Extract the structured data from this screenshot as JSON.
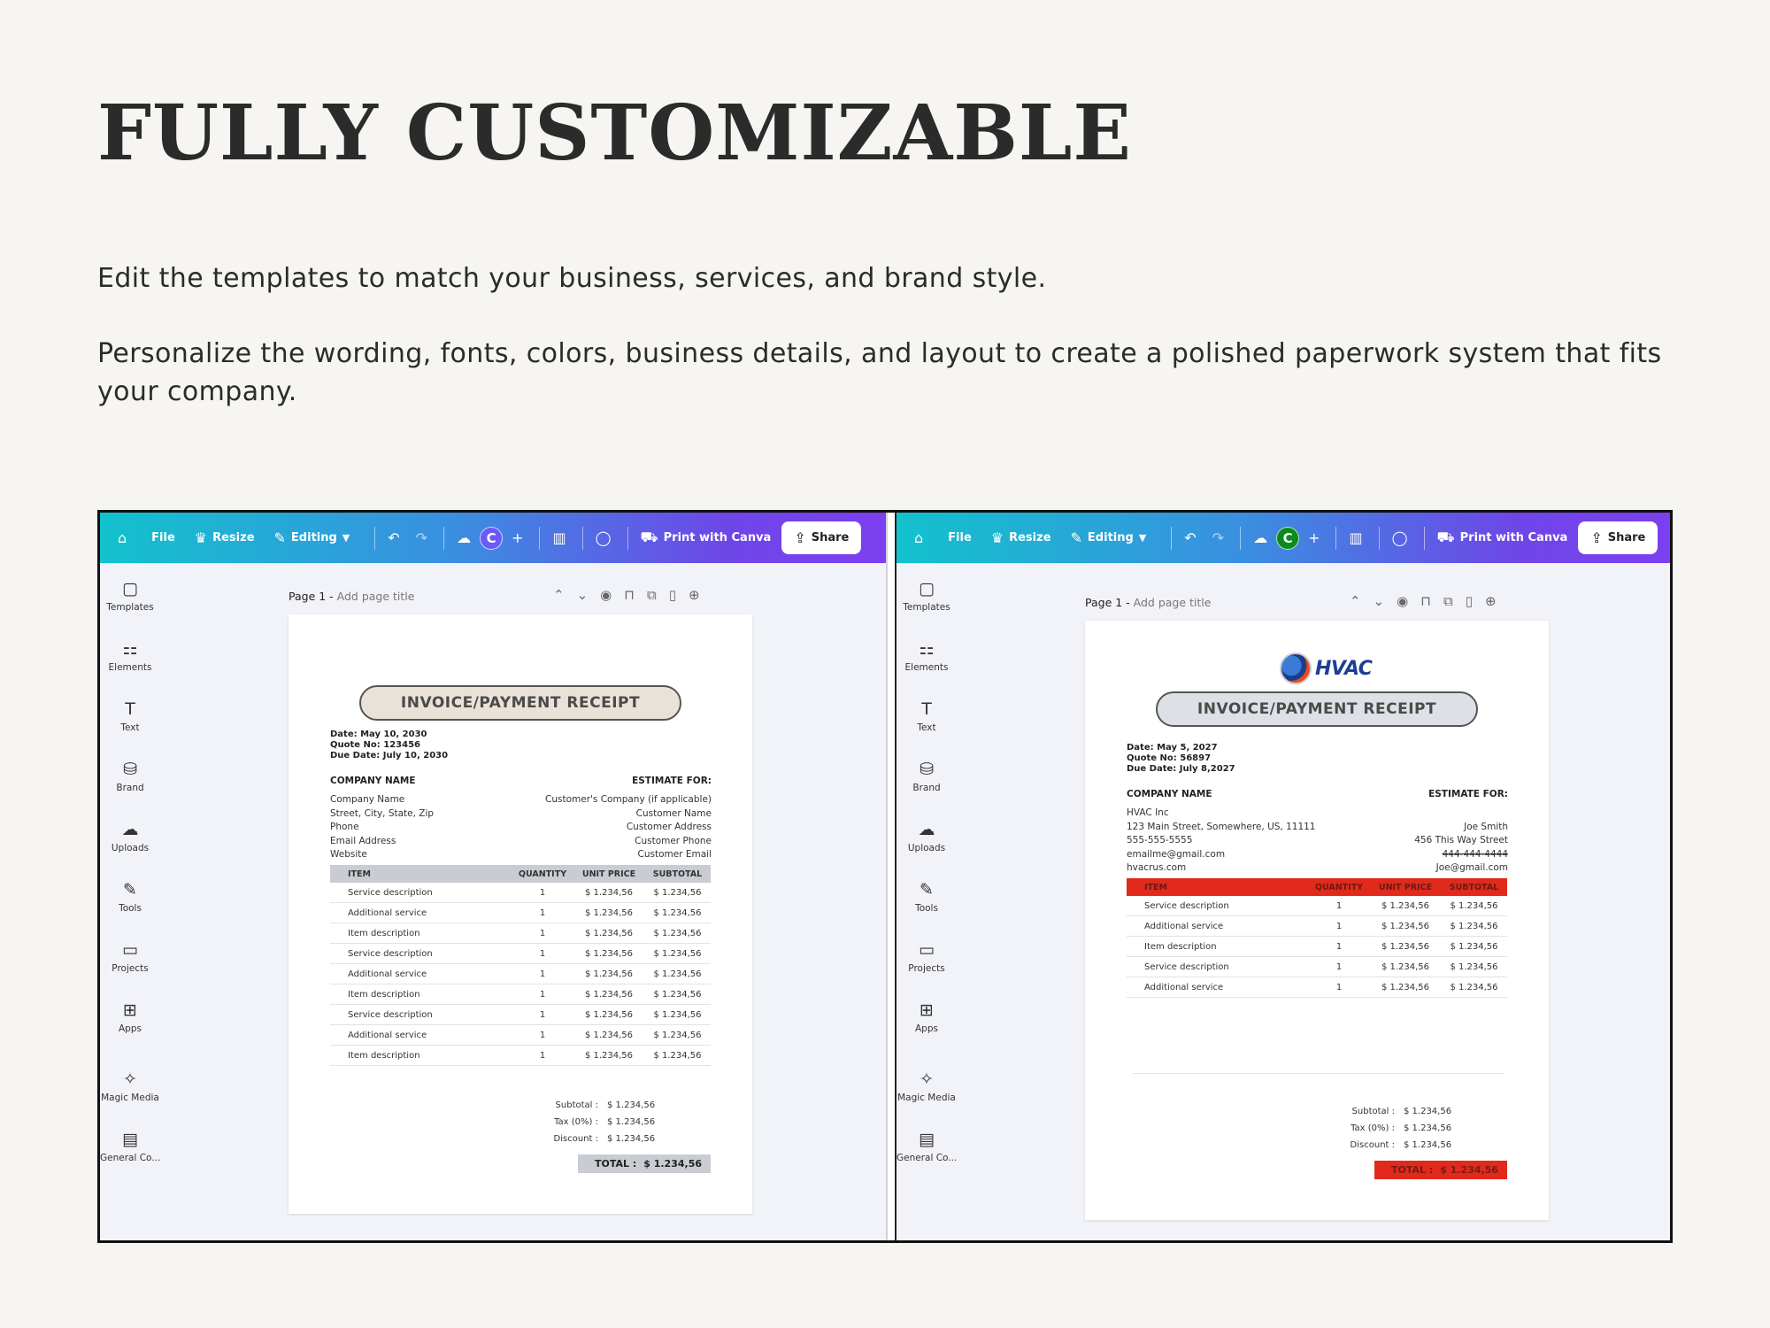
{
  "headline": "FULLY CUSTOMIZABLE",
  "paragraph1": "Edit the templates to match your business, services, and brand style.",
  "paragraph2": " Personalize the wording, fonts, colors, business details, and layout to create a polished paperwork system that fits your company.",
  "editor": {
    "toolbar": {
      "file": "File",
      "resize": "Resize",
      "editing": "Editing",
      "avatar_initial": "C",
      "print": "Print with Canva",
      "share": "Share"
    },
    "sidebar": [
      {
        "label": "Templates",
        "icon": "templates-icon",
        "glyph": "▢"
      },
      {
        "label": "Elements",
        "icon": "elements-icon",
        "glyph": "⚏"
      },
      {
        "label": "Text",
        "icon": "text-icon",
        "glyph": "T"
      },
      {
        "label": "Brand",
        "icon": "brand-icon",
        "glyph": "⛁"
      },
      {
        "label": "Uploads",
        "icon": "uploads-icon",
        "glyph": "☁"
      },
      {
        "label": "Tools",
        "icon": "tools-icon",
        "glyph": "✎"
      },
      {
        "label": "Projects",
        "icon": "projects-icon",
        "glyph": "▭"
      },
      {
        "label": "Apps",
        "icon": "apps-icon",
        "glyph": "⊞"
      },
      {
        "label": "Magic Media",
        "icon": "magic-media-icon",
        "glyph": "✧"
      },
      {
        "label": "General Co...",
        "icon": "general-contract-icon",
        "glyph": "▤"
      }
    ],
    "page_label": "Page 1 -",
    "page_title_placeholder": "Add page title"
  },
  "left_doc": {
    "title": "INVOICE/PAYMENT RECEIPT",
    "dates": [
      "Date: May 10, 2030",
      "Quote No: 123456",
      "Due Date: July 10, 2030"
    ],
    "company_heading": "COMPANY NAME",
    "estimate_heading": "ESTIMATE FOR:",
    "company_info": [
      "Company Name",
      "Street, City, State, Zip",
      "Phone",
      "Email Address",
      "Website"
    ],
    "customer_info": [
      "Customer's Company (if applicable)",
      "Customer Name",
      "Customer Address",
      "Customer Phone",
      "Customer Email"
    ],
    "columns": [
      "ITEM",
      "QUANTITY",
      "UNIT PRICE",
      "SUBTOTAL"
    ],
    "rows": [
      [
        "Service description",
        "1",
        "$ 1.234,56",
        "$ 1.234,56"
      ],
      [
        "Additional service",
        "1",
        "$ 1.234,56",
        "$ 1.234,56"
      ],
      [
        "Item description",
        "1",
        "$ 1.234,56",
        "$ 1.234,56"
      ],
      [
        "Service description",
        "1",
        "$ 1.234,56",
        "$ 1.234,56"
      ],
      [
        "Additional service",
        "1",
        "$ 1.234,56",
        "$ 1.234,56"
      ],
      [
        "Item description",
        "1",
        "$ 1.234,56",
        "$ 1.234,56"
      ],
      [
        "Service description",
        "1",
        "$ 1.234,56",
        "$ 1.234,56"
      ],
      [
        "Additional service",
        "1",
        "$ 1.234,56",
        "$ 1.234,56"
      ],
      [
        "Item description",
        "1",
        "$ 1.234,56",
        "$ 1.234,56"
      ]
    ],
    "totals": [
      [
        "Subtotal :",
        "$ 1.234,56"
      ],
      [
        "Tax (0%) :",
        "$ 1.234,56"
      ],
      [
        "Discount :",
        "$ 1.234,56"
      ]
    ],
    "total_label": "TOTAL :",
    "total_value": "$ 1.234,56"
  },
  "right_doc": {
    "logo_text": "HVAC",
    "title": "INVOICE/PAYMENT RECEIPT",
    "dates": [
      "Date: May 5, 2027",
      "Quote No: 56897",
      "Due Date: July 8,2027"
    ],
    "company_heading": "COMPANY NAME",
    "estimate_heading": "ESTIMATE FOR:",
    "company_info": [
      "HVAC Inc",
      "123 Main Street, Somewhere, US, 11111",
      "555-555-5555",
      "emailme@gmail.com",
      "hvacrus.com"
    ],
    "customer_info": [
      "",
      "Joe Smith",
      "456 This Way Street",
      "444-444-4444",
      "Joe@gmail.com"
    ],
    "columns": [
      "ITEM",
      "QUANTITY",
      "UNIT PRICE",
      "SUBTOTAL"
    ],
    "rows": [
      [
        "Service description",
        "1",
        "$ 1.234,56",
        "$ 1.234,56"
      ],
      [
        "Additional service",
        "1",
        "$ 1.234,56",
        "$ 1.234,56"
      ],
      [
        "Item description",
        "1",
        "$ 1.234,56",
        "$ 1.234,56"
      ],
      [
        "Service description",
        "1",
        "$ 1.234,56",
        "$ 1.234,56"
      ],
      [
        "Additional service",
        "1",
        "$ 1.234,56",
        "$ 1.234,56"
      ]
    ],
    "totals": [
      [
        "Subtotal :",
        "$ 1.234,56"
      ],
      [
        "Tax (0%) :",
        "$ 1.234,56"
      ],
      [
        "Discount :",
        "$ 1.234,56"
      ]
    ],
    "total_label": "TOTAL :",
    "total_value": "$ 1.234,56"
  },
  "colors": {
    "toolbar_start": "#12c2cd",
    "toolbar_end": "#7d3ff0",
    "right_accent": "#e12a1b",
    "left_title_fill": "#e9e2d8"
  }
}
